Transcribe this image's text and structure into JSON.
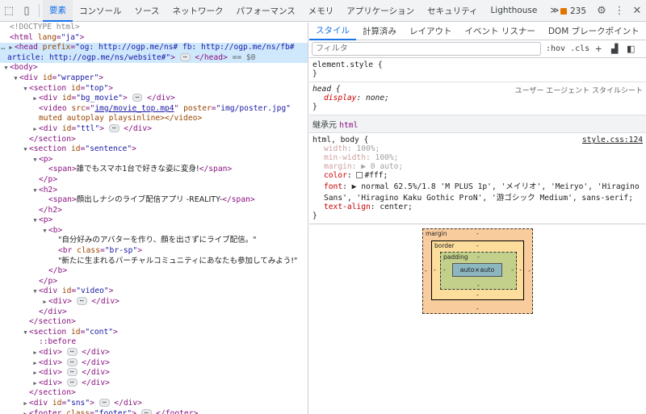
{
  "toolbar": {
    "tabs": [
      "要素",
      "コンソール",
      "ソース",
      "ネットワーク",
      "パフォーマンス",
      "メモリ",
      "アプリケーション",
      "セキュリティ",
      "Lighthouse"
    ],
    "more": "≫",
    "issues_count": "235"
  },
  "dom": {
    "doctype": "<!DOCTYPE html>",
    "html_tag": "html",
    "html_attr": "lang",
    "html_lang": "\"ja\"",
    "head_prefix": "\"og: http://ogp.me/ns# fb: http://ogp.me/ns/fb# article: http://ogp.me/ns/website#\"",
    "head_eq": "== $0",
    "wrapper_id": "\"wrapper\"",
    "top_id": "\"top\"",
    "bg_movie_id": "\"bg_movie\"",
    "video_src": "img/movie_top.mp4",
    "video_poster": "\"img/poster.jpg\"",
    "video_tail": "muted autoplay playsinline></video>",
    "ttl_id": "\"ttl\"",
    "sentence_id": "\"sentence\"",
    "span1": "誰でもスマホ1台で好きな姿に変身!",
    "span2": "顔出しナシのライブ配信アプリ -REALITY-",
    "b_text1": "\"自分好みのアバターを作り、顔を出さずにライブ配信。\"",
    "br_class": "\"br-sp\"",
    "b_text2": "\"新たに生まれるバーチャルコミュニティにあなたも参加してみよう!\"",
    "video_id": "\"video\"",
    "cont_id": "\"cont\"",
    "before": "::before",
    "sns_id": "\"sns\"",
    "footer_class": "\"footer\""
  },
  "styles": {
    "tabs": [
      "スタイル",
      "計算済み",
      "レイアウト",
      "イベント リスナー",
      "DOM ブレークポイント"
    ],
    "filter_placeholder": "フィルタ",
    "hov": ":hov",
    "cls": ".cls",
    "element_style": "element.style {",
    "head_selector": "head {",
    "head_prop": "display",
    "head_val": "none;",
    "ua_label": "ユーザー エージェント スタイルシート",
    "inherited_label": "継承元",
    "inherited_from": "html",
    "html_selector": "html, body {",
    "html_source": "style.css:124",
    "props": [
      {
        "name": "width",
        "value": "100%;"
      },
      {
        "name": "min-width",
        "value": "100%;"
      },
      {
        "name": "margin",
        "value": "▶ 0 auto;"
      },
      {
        "name": "color",
        "value": "#fff;"
      },
      {
        "name": "font",
        "value": "▶ normal 62.5%/1.8 'M PLUS 1p', 'メイリオ', 'Meiryo', 'Hiragino Sans', 'Hiragino Kaku Gothic ProN', '游ゴシック Medium', sans-serif;"
      },
      {
        "name": "text-align",
        "value": "center;"
      }
    ]
  },
  "boxmodel": {
    "margin_label": "margin",
    "border_label": "border",
    "padding_label": "padding",
    "content": "auto×auto",
    "dash": "-"
  }
}
